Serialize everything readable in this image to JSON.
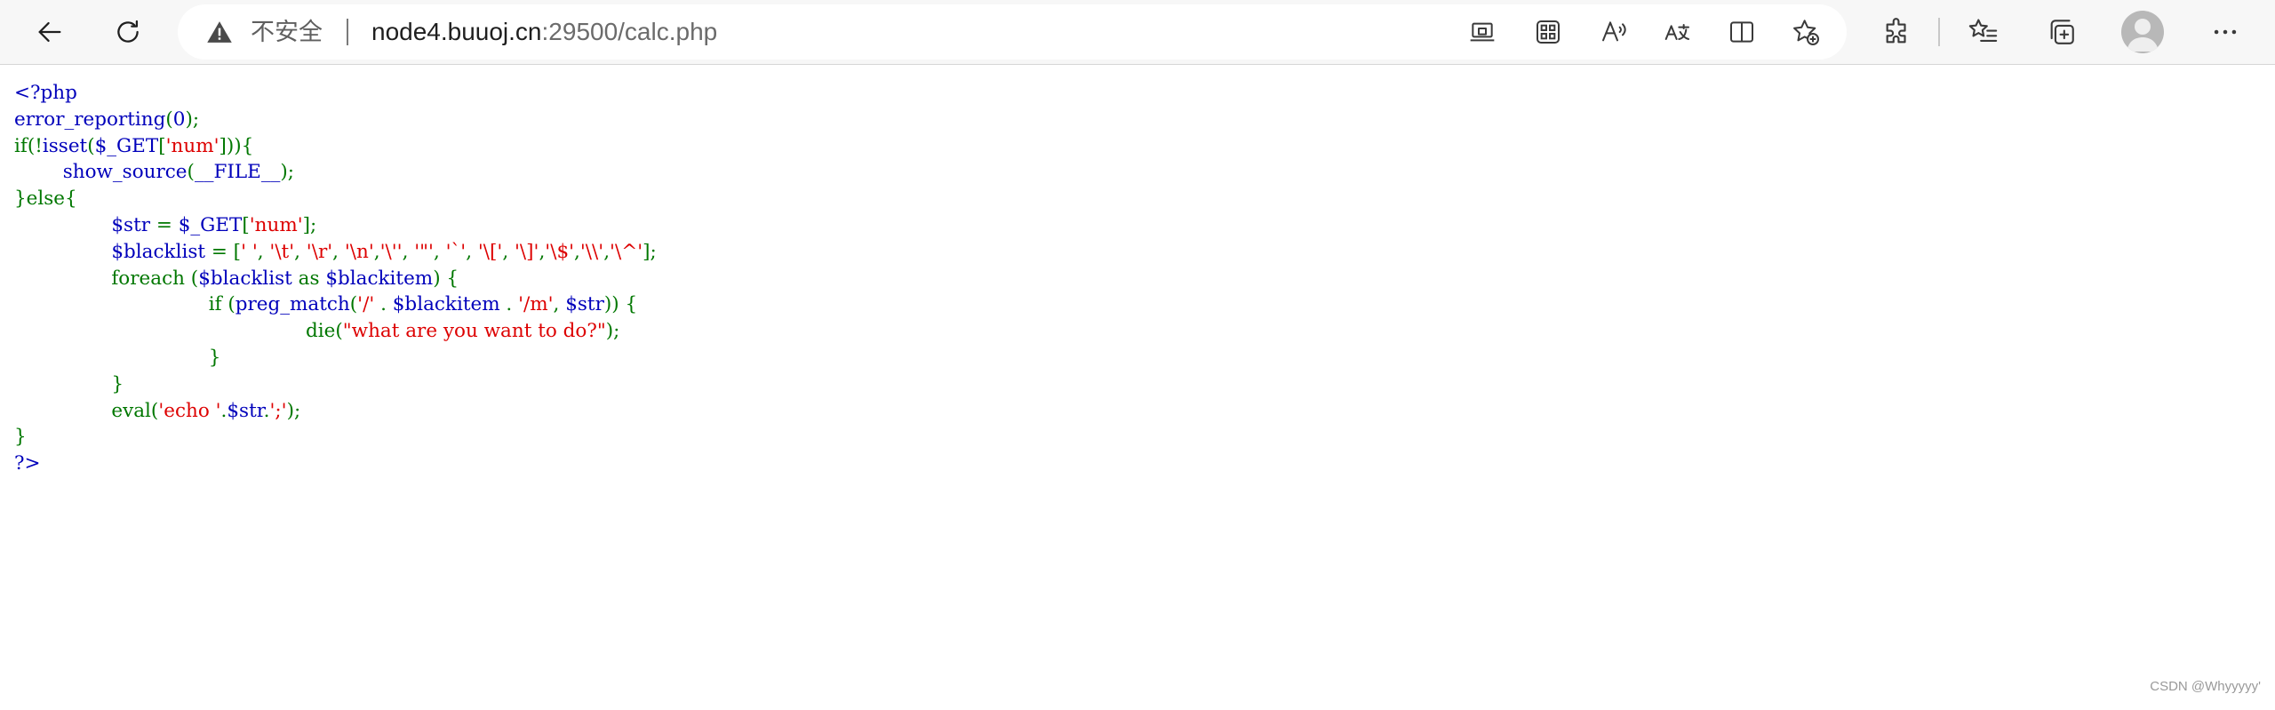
{
  "browser": {
    "security_label": "不安全",
    "url_host": "node4.buuoj.cn",
    "url_rest": ":29500/calc.php",
    "toolbar_icons": [
      "back-arrow-icon",
      "refresh-icon",
      "warning-triangle-icon",
      "app-available-icon",
      "qr-code-icon",
      "read-aloud-icon",
      "translate-icon",
      "split-screen-icon",
      "add-favorite-icon",
      "extensions-icon",
      "favorites-icon",
      "collections-icon",
      "profile-avatar",
      "more-menu-icon"
    ]
  },
  "colors": {
    "php_default": "#0000BB",
    "php_keyword": "#007700",
    "php_string": "#DD0000",
    "toolbar_bg": "#f7f7f7"
  },
  "source": {
    "lines": [
      [
        [
          "d",
          "<?php"
        ]
      ],
      [
        [
          "d",
          "error_reporting"
        ],
        [
          "k",
          "("
        ],
        [
          "d",
          "0"
        ],
        [
          "k",
          ");"
        ]
      ],
      [
        [
          "k",
          "if(!"
        ],
        [
          "d",
          "isset"
        ],
        [
          "k",
          "("
        ],
        [
          "d",
          "$_GET"
        ],
        [
          "k",
          "["
        ],
        [
          "s",
          "'num'"
        ],
        [
          "k",
          "])){"
        ]
      ],
      [
        [
          "k",
          "        "
        ],
        [
          "d",
          "show_source"
        ],
        [
          "k",
          "("
        ],
        [
          "d",
          "__FILE__"
        ],
        [
          "k",
          ");"
        ]
      ],
      [
        [
          "k",
          "}else{"
        ]
      ],
      [
        [
          "k",
          "                "
        ],
        [
          "d",
          "$str "
        ],
        [
          "k",
          "= "
        ],
        [
          "d",
          "$_GET"
        ],
        [
          "k",
          "["
        ],
        [
          "s",
          "'num'"
        ],
        [
          "k",
          "];"
        ]
      ],
      [
        [
          "k",
          "                "
        ],
        [
          "d",
          "$blacklist "
        ],
        [
          "k",
          "= ["
        ],
        [
          "s",
          "' '"
        ],
        [
          "k",
          ", "
        ],
        [
          "s",
          "'\\t'"
        ],
        [
          "k",
          ", "
        ],
        [
          "s",
          "'\\r'"
        ],
        [
          "k",
          ", "
        ],
        [
          "s",
          "'\\n'"
        ],
        [
          "k",
          ","
        ],
        [
          "s",
          "'\\''"
        ],
        [
          "k",
          ", "
        ],
        [
          "s",
          "'\"'"
        ],
        [
          "k",
          ", "
        ],
        [
          "s",
          "'`'"
        ],
        [
          "k",
          ", "
        ],
        [
          "s",
          "'\\['"
        ],
        [
          "k",
          ", "
        ],
        [
          "s",
          "'\\]'"
        ],
        [
          "k",
          ","
        ],
        [
          "s",
          "'\\$'"
        ],
        [
          "k",
          ","
        ],
        [
          "s",
          "'\\\\'"
        ],
        [
          "k",
          ","
        ],
        [
          "s",
          "'\\^'"
        ],
        [
          "k",
          "];"
        ]
      ],
      [
        [
          "k",
          "                foreach ("
        ],
        [
          "d",
          "$blacklist "
        ],
        [
          "k",
          "as "
        ],
        [
          "d",
          "$blackitem"
        ],
        [
          "k",
          ") {"
        ]
      ],
      [
        [
          "k",
          "                                if ("
        ],
        [
          "d",
          "preg_match"
        ],
        [
          "k",
          "("
        ],
        [
          "s",
          "'/' "
        ],
        [
          "k",
          ". "
        ],
        [
          "d",
          "$blackitem "
        ],
        [
          "k",
          ". "
        ],
        [
          "s",
          "'/m'"
        ],
        [
          "k",
          ", "
        ],
        [
          "d",
          "$str"
        ],
        [
          "k",
          ")) {"
        ]
      ],
      [
        [
          "k",
          "                                                die("
        ],
        [
          "s",
          "\"what are you want to do?\""
        ],
        [
          "k",
          ");"
        ]
      ],
      [
        [
          "k",
          "                                }"
        ]
      ],
      [
        [
          "k",
          "                }"
        ]
      ],
      [
        [
          "k",
          "                eval("
        ],
        [
          "s",
          "'echo '"
        ],
        [
          "k",
          "."
        ],
        [
          "d",
          "$str"
        ],
        [
          "k",
          "."
        ],
        [
          "s",
          "';'"
        ],
        [
          "k",
          ");"
        ]
      ],
      [
        [
          "k",
          "}"
        ]
      ],
      [
        [
          "d",
          "?>"
        ]
      ]
    ]
  },
  "watermark": "CSDN @Whyyyyy'"
}
